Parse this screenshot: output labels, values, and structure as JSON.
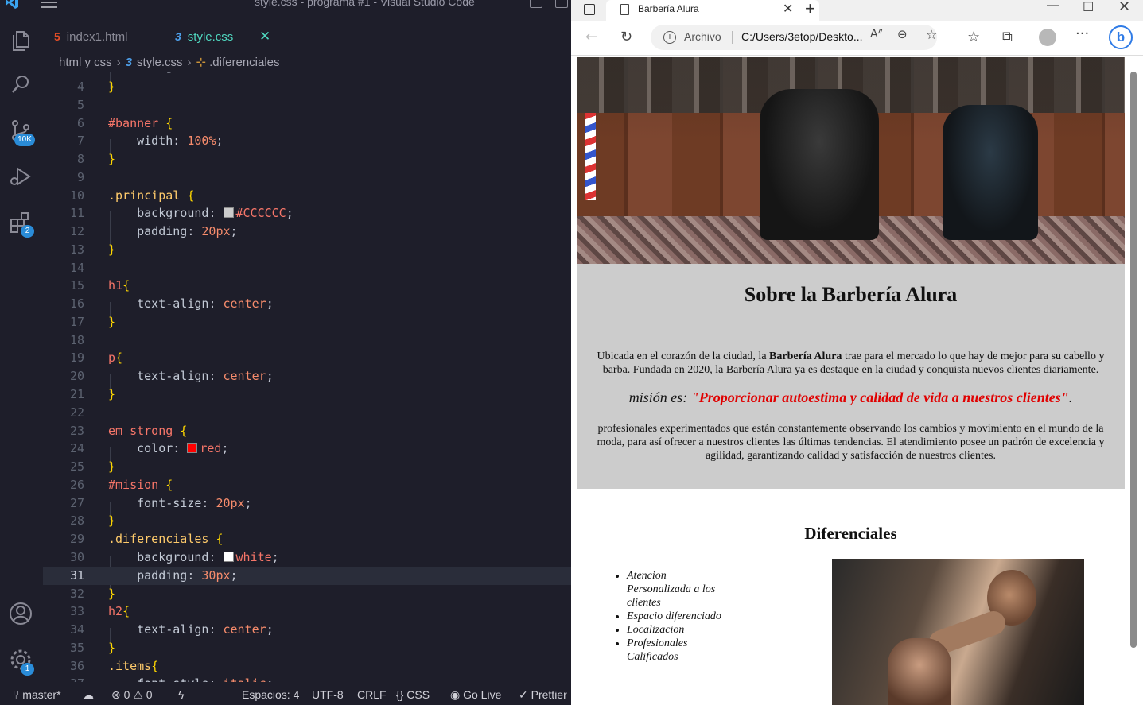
{
  "vscode": {
    "window_title": "style.css - programa #1 - Visual Studio Code",
    "activity_badges": {
      "source_control": "10K",
      "extensions": "2",
      "settings": "1"
    },
    "tabs": [
      {
        "label": "index1.html",
        "icon": "html-file-icon"
      },
      {
        "label": "style.css",
        "icon": "css-file-icon",
        "active": true
      }
    ],
    "breadcrumb": {
      "folder": "html y css",
      "file": "style.css",
      "symbol": ".diferenciales"
    },
    "colors": {
      "selector": "#f77669",
      "class": "#ffcb6b",
      "value": "#f78c6c",
      "accent": "#4fd6be"
    },
    "active_line": 31,
    "status": {
      "branch": "master*",
      "errors": "0",
      "warnings": "0",
      "spaces": "Espacios: 4",
      "encoding": "UTF-8",
      "eol": "CRLF",
      "language": "CSS",
      "golive": "Go Live",
      "prettier": "Prettier"
    }
  },
  "edge": {
    "tab_title": "Barbería Alura",
    "address_label": "Archivo",
    "address_url": "C:/Users/3etop/Deskto...",
    "page": {
      "principal_title": "Sobre la Barbería Alura",
      "para1_before": "Ubicada en el corazón de la ciudad, la ",
      "para1_strong": "Barbería Alura",
      "para1_after": " trae para el mercado lo que hay de mejor para su cabello y barba. Fundada en 2020, la Barbería Alura ya es destaque en la ciudad y conquista nuevos clientes diariamente.",
      "mision_prefix": "misión es: ",
      "mision_strong": "\"Proporcionar autoestima y calidad de vida a nuestros clientes\"",
      "mision_suffix": ".",
      "para2": "profesionales experimentados que están constantemente observando los cambios y movimiento en el mundo de la moda, para así ofrecer a nuestros clientes las últimas tendencias. El atendimiento posee un padrón de excelencia y agilidad, garantizando calidad y satisfacción de nuestros clientes.",
      "diferenciales_title": "Diferenciales",
      "diferenciales_items": [
        "Atencion Personalizada a los clientes",
        "Espacio diferenciado",
        "Localizacion",
        "Profesionales Calificados"
      ],
      "principal_bg": "#CCCCCC",
      "mision_color": "red"
    }
  }
}
